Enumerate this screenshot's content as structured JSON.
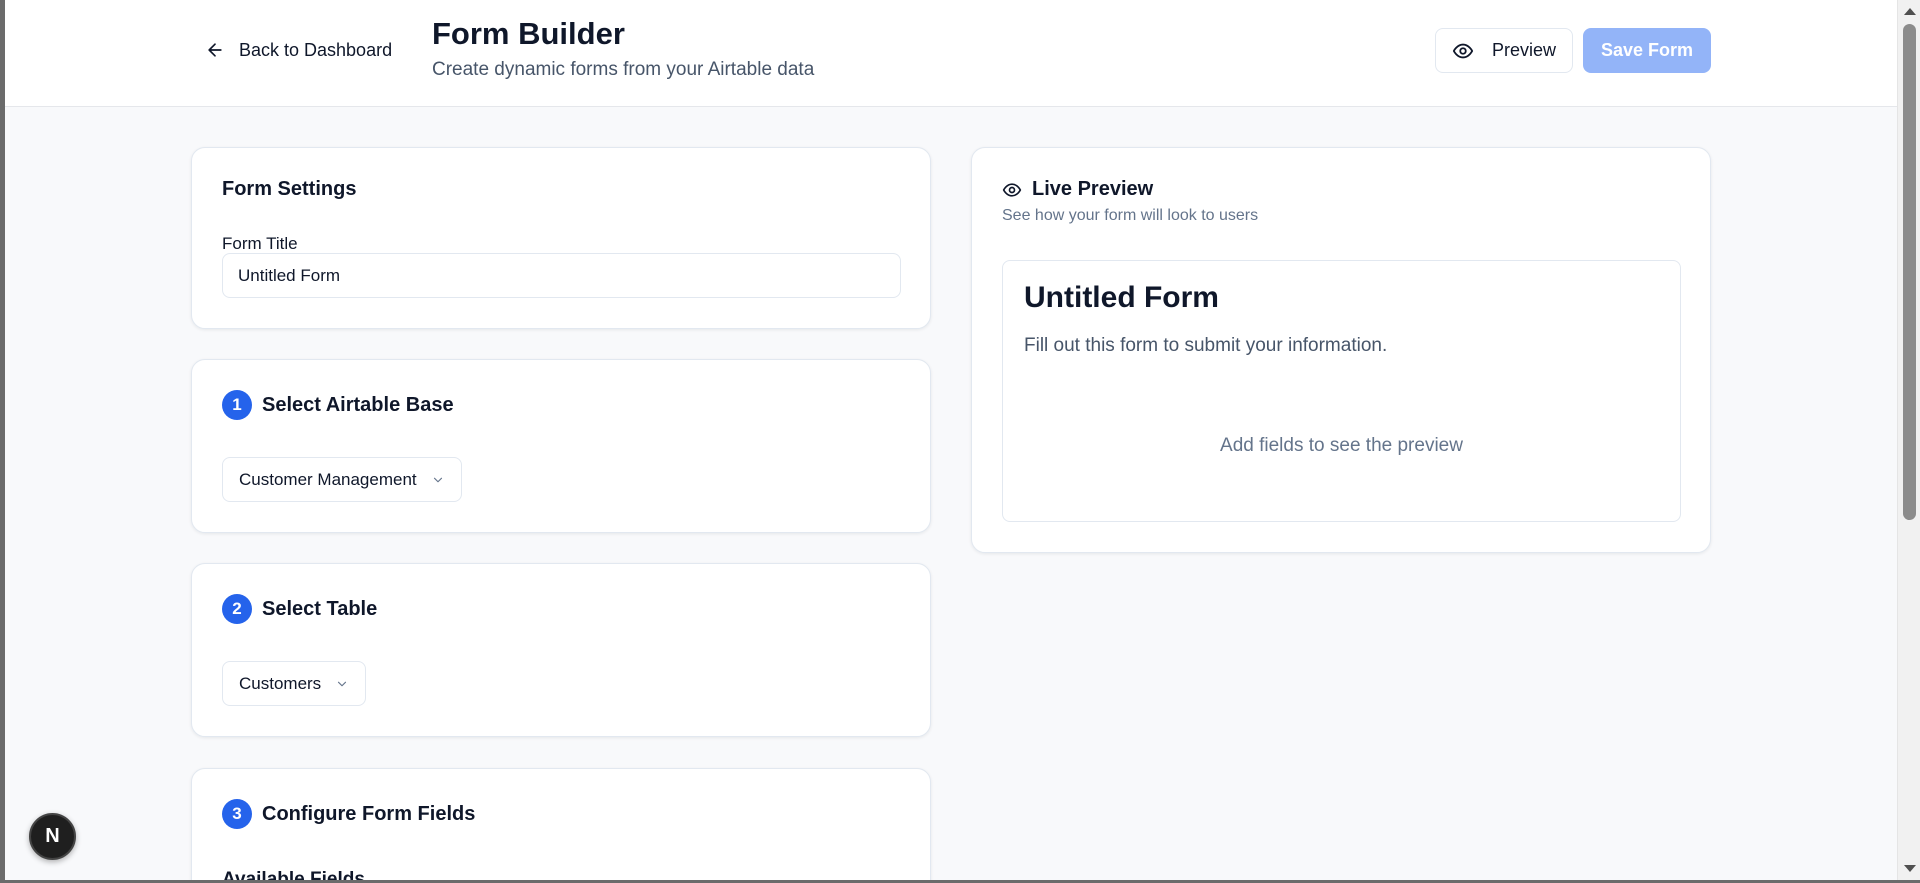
{
  "header": {
    "back_label": "Back to Dashboard",
    "title": "Form Builder",
    "subtitle": "Create dynamic forms from your Airtable data",
    "preview_label": "Preview",
    "save_label": "Save Form"
  },
  "form_settings": {
    "title": "Form Settings",
    "form_title_label": "Form Title",
    "form_title_value": "Untitled Form"
  },
  "steps": [
    {
      "number": "1",
      "title": "Select Airtable Base",
      "selected": "Customer Management"
    },
    {
      "number": "2",
      "title": "Select Table",
      "selected": "Customers"
    },
    {
      "number": "3",
      "title": "Configure Form Fields",
      "sub_label": "Available Fields"
    }
  ],
  "preview": {
    "title": "Live Preview",
    "description": "See how your form will look to users",
    "form_title": "Untitled Form",
    "form_description": "Fill out this form to submit your information.",
    "empty_message": "Add fields to see the preview"
  },
  "dev_badge": {
    "letter": "N"
  },
  "colors": {
    "accent": "#2563eb",
    "save_disabled": "#93b4f8",
    "background": "#f8f9fb"
  },
  "icons": {
    "back": "arrow-left-icon",
    "preview": "eye-icon",
    "select": "chevron-down-icon"
  }
}
